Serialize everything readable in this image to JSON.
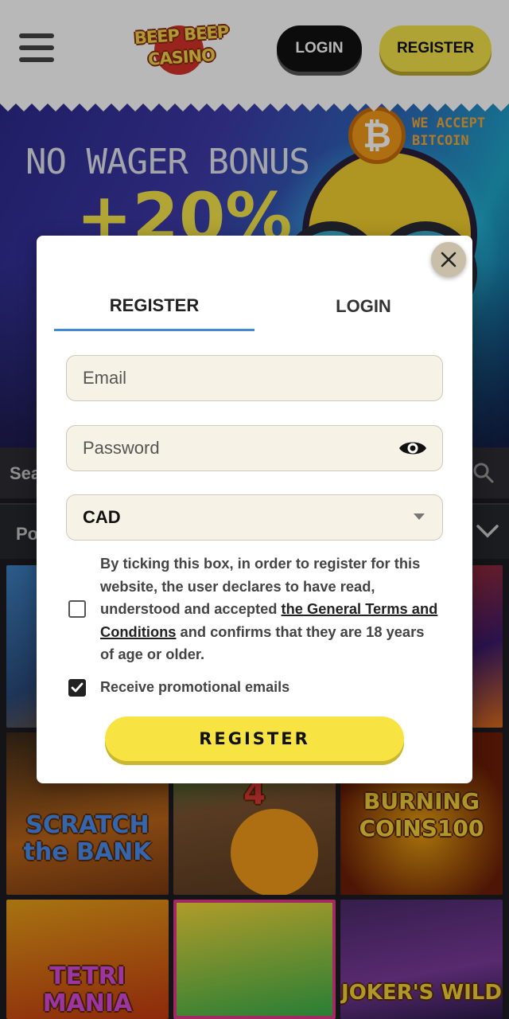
{
  "header": {
    "logo_line1": "BEEP BEEP",
    "logo_line2": "CASINO",
    "login_label": "LOGIN",
    "register_label": "REGISTER"
  },
  "banner": {
    "title": "NO WAGER BONUS",
    "percent": "+20%",
    "bitcoin_text": "WE ACCEPT BITCOIN"
  },
  "search": {
    "placeholder_visible": "Sea"
  },
  "providers": {
    "visible_text": "Po"
  },
  "games": [
    {
      "label": ""
    },
    {
      "label": ""
    },
    {
      "label": ""
    },
    {
      "label": "SCRATCH the BANK"
    },
    {
      "label": "4"
    },
    {
      "label": "BURNING COINS100"
    },
    {
      "label": "TETRI MANIA"
    },
    {
      "label": ""
    },
    {
      "label": "JOKER'S WILD"
    }
  ],
  "modal": {
    "tabs": {
      "register": "REGISTER",
      "login": "LOGIN"
    },
    "email_placeholder": "Email",
    "password_placeholder": "Password",
    "currency_value": "CAD",
    "terms_before": "By ticking this box, in order to register for this website, the user declares to have read, understood and accepted ",
    "terms_link": "the General Terms and Conditions",
    "terms_after": " and confirms that they are 18 years of age or older.",
    "terms_checked": false,
    "promo_label": "Receive promotional emails",
    "promo_checked": true,
    "submit_label": "REGISTER"
  },
  "colors": {
    "accent_yellow": "#f7e443",
    "tab_underline": "#3f8bd3",
    "field_bg": "#f6f2e6"
  },
  "icons": [
    "hamburger-icon",
    "close-icon",
    "eye-icon",
    "chevron-down-icon",
    "search-icon",
    "checkmark-icon",
    "bitcoin-icon"
  ]
}
